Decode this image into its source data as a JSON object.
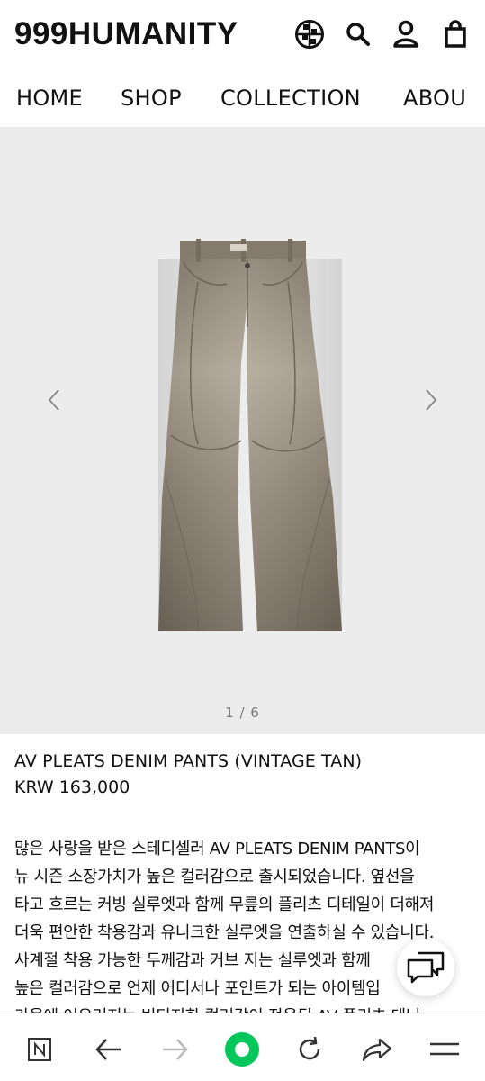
{
  "header": {
    "logo": "999HUMANITY",
    "icons": [
      "globe-grid-icon",
      "search-icon",
      "user-icon",
      "shopping-bag-icon"
    ]
  },
  "nav": {
    "items": [
      {
        "label": "HOME"
      },
      {
        "label": "SHOP"
      },
      {
        "label": "COLLECTION"
      },
      {
        "label": "ABOU"
      }
    ]
  },
  "gallery": {
    "counter": "1 / 6",
    "current": 1,
    "total": 6,
    "background": "#ececec"
  },
  "product": {
    "title": "AV PLEATS DENIM PANTS (VINTAGE TAN)",
    "price": "KRW 163,000",
    "description": "많은 사랑을 받은 스테디셀러 AV PLEATS DENIM PANTS이\n뉴 시즌 소장가치가 높은 컬러감으로 출시되었습니다. 옆선을\n타고 흐르는 커빙 실루엣과 함께 무릎의 플리츠 디테일이 더해져\n더욱 편안한 착용감과 유니크한 실루엣을 연출하실 수 있습니다.\n사계절 착용 가능한 두께감과 커브 지는 실루엣과 함께\n높은 컬러감으로 언제 어디서나 포인트가 되는 아이템입\n가을에 어우러지는 빈티지한 컬러감이 적용된 AV 플리츠 데님"
  },
  "browser_bar": {
    "icons": [
      "naver-n-icon",
      "back-arrow-icon",
      "forward-arrow-icon",
      "green-home-circle-icon",
      "reload-icon",
      "share-icon",
      "menu-icon"
    ],
    "accent": "#03c75a"
  }
}
